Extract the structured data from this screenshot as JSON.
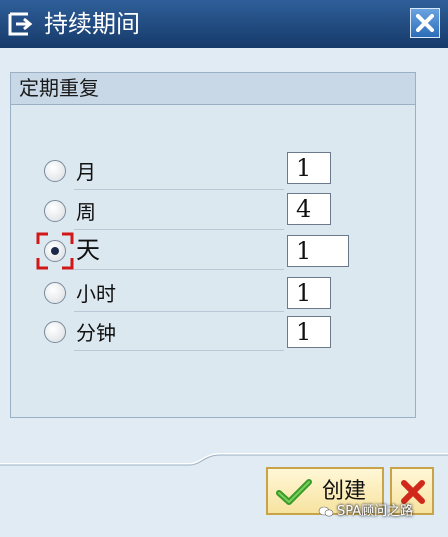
{
  "window": {
    "title": "持续期间",
    "close_icon": "close-icon"
  },
  "group": {
    "title": "定期重复",
    "options": [
      {
        "label": "月",
        "value": "1",
        "selected": false
      },
      {
        "label": "周",
        "value": "4",
        "selected": false
      },
      {
        "label": "天",
        "value": "1",
        "selected": true
      },
      {
        "label": "小时",
        "value": "1",
        "selected": false
      },
      {
        "label": "分钟",
        "value": "1",
        "selected": false
      }
    ]
  },
  "footer": {
    "create_label": "创建",
    "create_icon": "checkmark-icon",
    "cancel_icon": "cancel-x-icon"
  },
  "watermark": {
    "text": "SPA顾问之路"
  },
  "colors": {
    "titlebar": "#1e4a80",
    "body": "#e0ebf3",
    "button_border": "#c9a34a",
    "cancel_red": "#d0281a",
    "check_green": "#3a9a2a",
    "focus_red": "#d01818"
  }
}
